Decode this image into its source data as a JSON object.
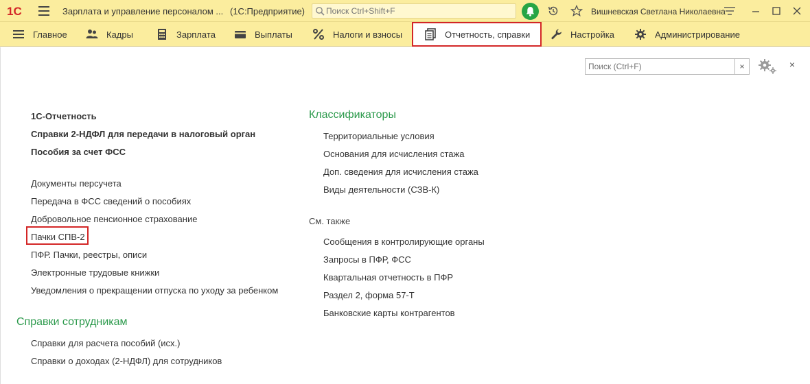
{
  "titlebar": {
    "logo_text": "1С",
    "app_title": "Зарплата и управление персоналом ...",
    "app_mode": "(1С:Предприятие)",
    "search_placeholder": "Поиск Ctrl+Shift+F",
    "user_name": "Вишневская Светлана Николаевна"
  },
  "menu": {
    "items": [
      {
        "label": "Главное",
        "icon": "list-icon"
      },
      {
        "label": "Кадры",
        "icon": "people-icon"
      },
      {
        "label": "Зарплата",
        "icon": "calculator-icon"
      },
      {
        "label": "Выплаты",
        "icon": "wallet-icon"
      },
      {
        "label": "Налоги и взносы",
        "icon": "percent-icon"
      },
      {
        "label": "Отчетность, справки",
        "icon": "documents-icon",
        "active": true
      },
      {
        "label": "Настройка",
        "icon": "wrench-icon"
      },
      {
        "label": "Администрирование",
        "icon": "gear-icon"
      }
    ]
  },
  "panel": {
    "search_placeholder": "Поиск (Ctrl+F)",
    "clear_label": "×",
    "close_label": "×"
  },
  "left_column": {
    "bold_links": [
      "1С-Отчетность",
      "Справки 2-НДФЛ для передачи в налоговый орган",
      "Пособия за счет ФСС"
    ],
    "links": [
      "Документы персучета",
      "Передача в ФСС сведений о пособиях",
      "Добровольное пенсионное страхование",
      "Пачки СПВ-2",
      "ПФР. Пачки, реестры, описи",
      "Электронные трудовые книжки",
      "Уведомления о прекращении отпуска по уходу за ребенком"
    ],
    "employee_section_title": "Справки сотрудникам",
    "employee_links": [
      "Справки для расчета пособий (исх.)",
      "Справки о доходах (2-НДФЛ) для сотрудников"
    ]
  },
  "right_column": {
    "classifiers_title": "Классификаторы",
    "classifiers": [
      "Территориальные условия",
      "Основания для исчисления стажа",
      "Доп. сведения для исчисления стажа",
      "Виды деятельности (СЗВ-К)"
    ],
    "see_also_title": "См. также",
    "see_also": [
      "Сообщения в контролирующие органы",
      "Запросы в ПФР, ФСС",
      "Квартальная отчетность в ПФР",
      "Раздел 2, форма 57-Т",
      "Банковские карты контрагентов"
    ]
  },
  "colors": {
    "bar_bg": "#fbed9e",
    "section_green": "#2c9a4c",
    "highlight_red": "#d32626",
    "notification_green": "#27a545"
  }
}
